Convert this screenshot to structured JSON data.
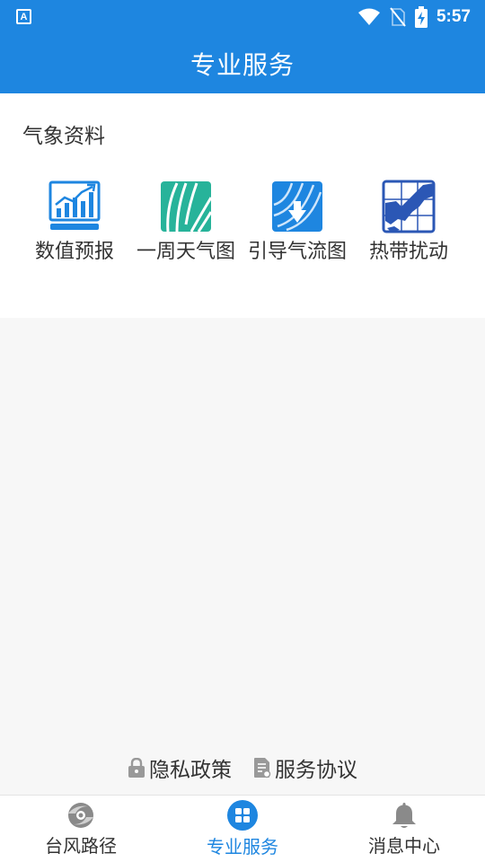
{
  "status_bar": {
    "time": "5:57",
    "app_badge": "A"
  },
  "header": {
    "title": "专业服务"
  },
  "section": {
    "title": "气象资料",
    "items": [
      {
        "label": "数值预报",
        "icon": "chart-trend-icon"
      },
      {
        "label": "一周天气图",
        "icon": "weather-map-icon"
      },
      {
        "label": "引导气流图",
        "icon": "steering-flow-icon"
      },
      {
        "label": "热带扰动",
        "icon": "tropical-disturbance-icon"
      }
    ]
  },
  "footer": {
    "privacy_label": "隐私政策",
    "agreement_label": "服务协议"
  },
  "bottom_nav": {
    "items": [
      {
        "label": "台风路径",
        "icon": "typhoon-icon"
      },
      {
        "label": "专业服务",
        "icon": "grid-icon",
        "active": true
      },
      {
        "label": "消息中心",
        "icon": "bell-icon"
      }
    ]
  },
  "colors": {
    "primary": "#1e86e0",
    "teal": "#27b39a",
    "navy": "#2b57b5"
  }
}
